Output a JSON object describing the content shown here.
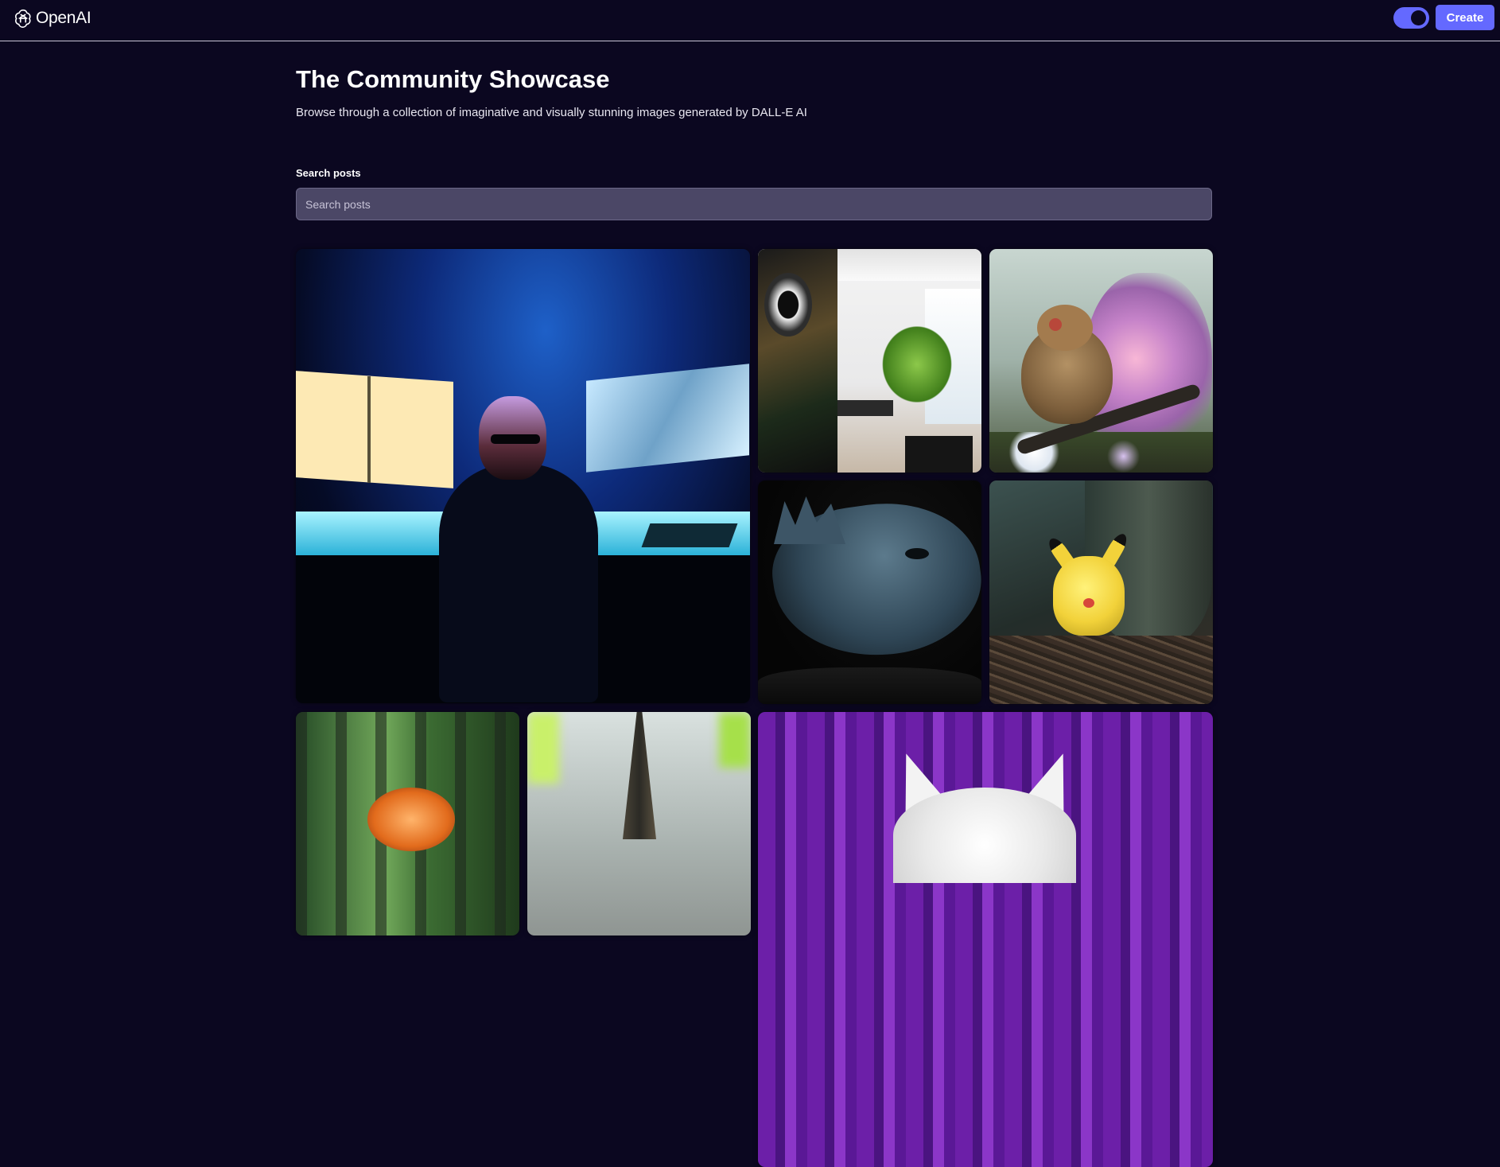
{
  "header": {
    "brand": "OpenAI",
    "logo_icon": "openai-logo-icon",
    "toggle_on": true,
    "create_label": "Create",
    "accent_color": "#6469ff",
    "background_color": "#0b0720"
  },
  "main": {
    "title": "The Community Showcase",
    "subtitle": "Browse through a collection of imaginative and visually stunning images generated by DALL-E AI",
    "search": {
      "label": "Search posts",
      "placeholder": "Search posts",
      "value": ""
    }
  },
  "gallery": {
    "cards": [
      {
        "name": "gallery-card-hacker-monitors"
      },
      {
        "name": "gallery-card-modern-interior"
      },
      {
        "name": "gallery-card-bird-blossoms"
      },
      {
        "name": "gallery-card-reptile"
      },
      {
        "name": "gallery-card-pikachu-forest"
      },
      {
        "name": "gallery-card-fish-forest"
      },
      {
        "name": "gallery-card-eiffel-painting"
      },
      {
        "name": "gallery-card-cat-curtain"
      }
    ]
  }
}
